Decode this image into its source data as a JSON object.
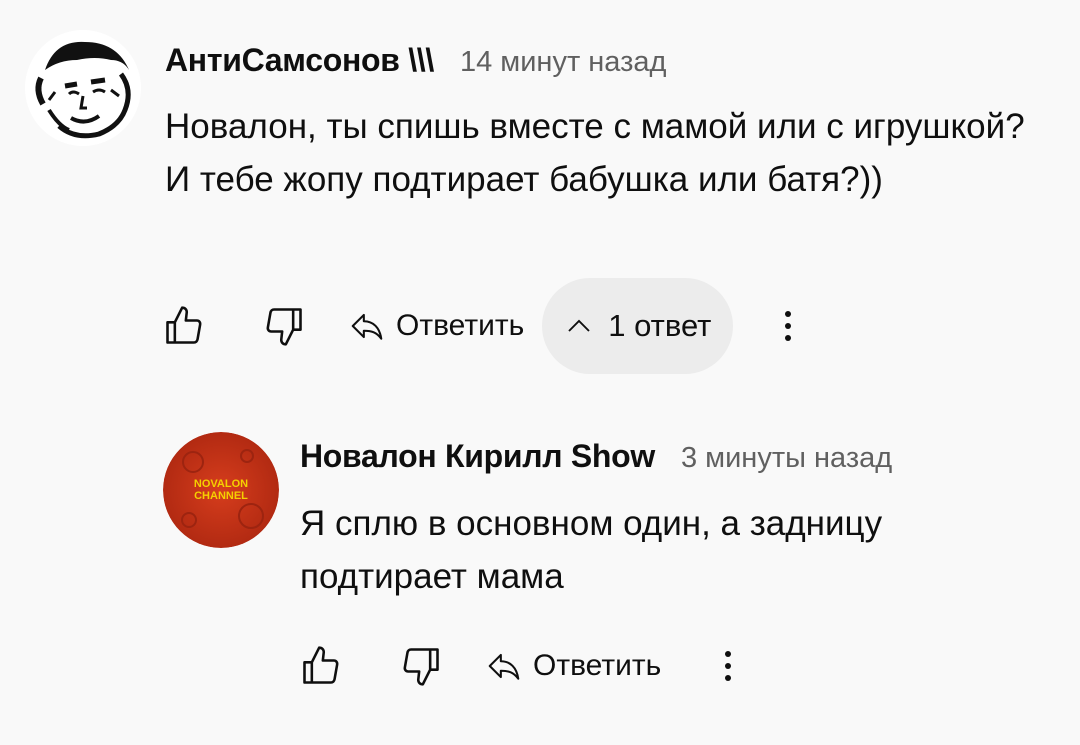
{
  "comments": [
    {
      "author": "АнтиСамсонов \\\\\\",
      "time": "14 минут назад",
      "text": "Новалон, ты спишь вместе с мамой или с игрушкой? И тебе жопу подтирает бабушка или батя?))",
      "reply_label": "Ответить",
      "replies_label": "1 ответ",
      "avatar_icon": "sketch-face-avatar"
    },
    {
      "author": "Новалон Кирилл Show",
      "time": "3 минуты назад",
      "text": "Я сплю в основном один, а задницу подтирает мама",
      "reply_label": "Ответить",
      "avatar_text_1": "NOVALON",
      "avatar_text_2": "CHANNEL",
      "avatar_color": "#c9361a"
    }
  ],
  "icons": [
    "like-icon",
    "dislike-icon",
    "reply-icon",
    "chevron-up-icon",
    "more-vert-icon"
  ]
}
